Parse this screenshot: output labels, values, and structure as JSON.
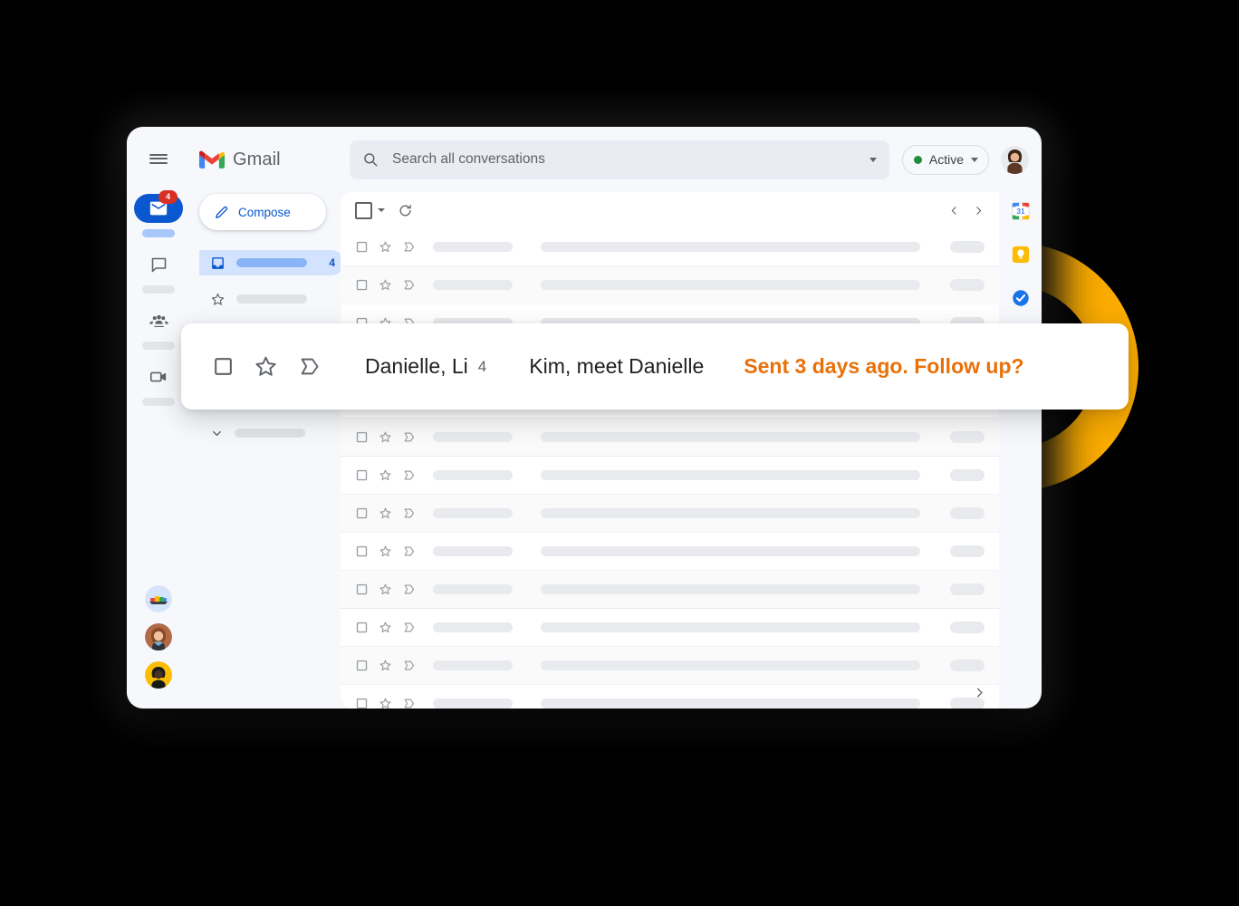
{
  "window": {
    "brand": "Gmail",
    "hamburger_icon": "hamburger-menu-icon",
    "gmail_logo_icon": "gmail-logo-icon"
  },
  "search": {
    "placeholder": "Search all conversations",
    "value": "",
    "search_icon": "search-icon",
    "options_icon": "chevron-down-icon"
  },
  "status": {
    "label": "Active",
    "dot_color": "#1E8E3E",
    "caret_icon": "chevron-down-icon"
  },
  "account": {
    "avatar_icon": "user-avatar"
  },
  "rail": {
    "items": [
      {
        "name": "mail",
        "icon": "mail-icon",
        "active": true,
        "badge": "4"
      },
      {
        "name": "chat",
        "icon": "chat-bubble-icon",
        "active": false,
        "badge": ""
      },
      {
        "name": "spaces",
        "icon": "spaces-people-icon",
        "active": false,
        "badge": ""
      },
      {
        "name": "meet",
        "icon": "video-camera-icon",
        "active": false,
        "badge": ""
      }
    ],
    "avatars": [
      {
        "name": "avatar-illustration"
      },
      {
        "name": "avatar-person-1"
      },
      {
        "name": "avatar-person-2"
      }
    ]
  },
  "nav": {
    "compose_label": "Compose",
    "compose_icon": "pencil-icon",
    "items": [
      {
        "name": "inbox",
        "icon": "inbox-icon",
        "selected": true,
        "count": "4"
      },
      {
        "name": "starred",
        "icon": "star-icon",
        "selected": false,
        "count": ""
      },
      {
        "name": "snoozed",
        "icon": "clock-icon",
        "selected": false,
        "count": ""
      },
      {
        "name": "more",
        "icon": "chevron-down-icon",
        "selected": false,
        "count": ""
      }
    ]
  },
  "toolbar": {
    "select_all_icon": "checkbox-icon",
    "select_all_caret_icon": "chevron-down-icon",
    "refresh_icon": "refresh-icon",
    "prev_icon": "chevron-left-icon",
    "next_icon": "chevron-right-icon"
  },
  "list": {
    "row_count": 14,
    "row_icons": [
      "checkbox-icon",
      "star-icon",
      "important-marker-icon"
    ],
    "next_page_icon": "chevron-right-icon"
  },
  "apps": [
    {
      "name": "google-calendar",
      "icon": "calendar-icon",
      "label": "31"
    },
    {
      "name": "google-keep",
      "icon": "keep-bulb-icon"
    },
    {
      "name": "google-tasks",
      "icon": "tasks-check-icon"
    }
  ],
  "highlight_card": {
    "checkbox_icon": "checkbox-icon",
    "star_icon": "star-icon",
    "important_icon": "important-marker-icon",
    "from": "Danielle, Li",
    "thread_count": "4",
    "subject": "Kim, meet Danielle",
    "note": "Sent 3 days ago. Follow up?",
    "note_color": "#E8710A"
  },
  "decoration": {
    "arc_color": "#F9AB00",
    "background_color": "#000000"
  }
}
